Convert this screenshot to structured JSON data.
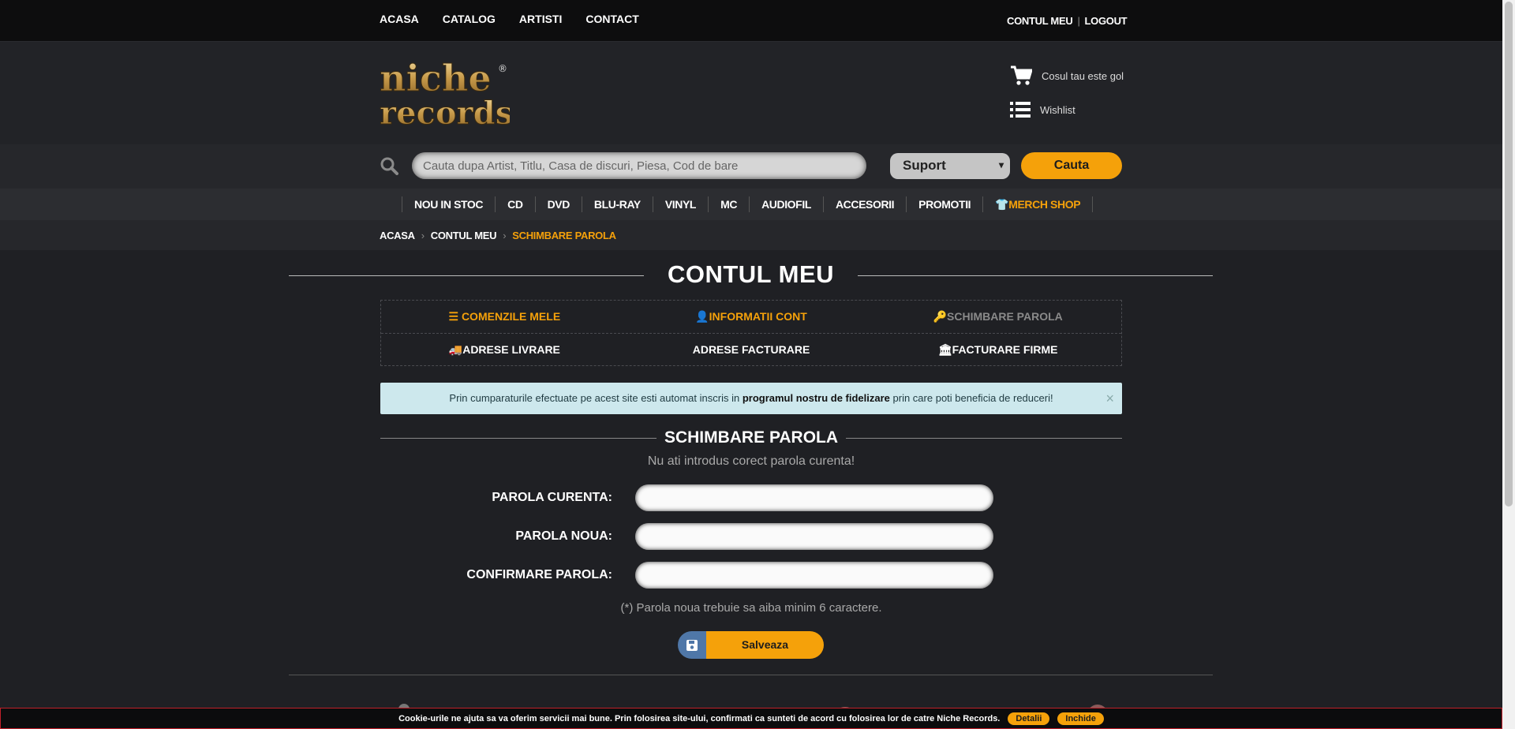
{
  "topnav": {
    "items": [
      "ACASA",
      "CATALOG",
      "ARTISTI",
      "CONTACT"
    ]
  },
  "account": {
    "contul_meu": "CONTUL MEU",
    "logout": "LOGOUT"
  },
  "logo": {
    "line1": "niche",
    "line2": "records",
    "reg": "®"
  },
  "cart": {
    "label": "Cosul tau este gol",
    "icon": "cart-icon"
  },
  "wishlist": {
    "label": "Wishlist",
    "icon": "list-icon"
  },
  "search": {
    "placeholder": "Cauta dupa Artist, Titlu, Casa de discuri, Piesa, Cod de bare",
    "suport": "Suport",
    "button": "Cauta"
  },
  "categories": [
    "NOU IN STOC",
    "CD",
    "DVD",
    "BLU-RAY",
    "VINYL",
    "MC",
    "AUDIOFIL",
    "ACCESORII",
    "PROMOTII",
    "MERCH SHOP"
  ],
  "breadcrumb": [
    "ACASA",
    "CONTUL MEU",
    "SCHIMBARE PAROLA"
  ],
  "page_title": "CONTUL MEU",
  "account_menu": {
    "comenzi": "COMENZILE MELE",
    "informatii": "INFORMATII CONT",
    "schimbare": "SCHIMBARE PAROLA",
    "adrese_livrare": "ADRESE LIVRARE",
    "adrese_facturare": "ADRESE FACTURARE",
    "facturare_firme": "FACTURARE FIRME"
  },
  "alert": {
    "before": "Prin cumparaturile efectuate pe acest site esti automat inscris in ",
    "bold": "programul nostru de fidelizare",
    "after": " prin care poti beneficia de reduceri!",
    "close": "×"
  },
  "section_title": "SCHIMBARE PAROLA",
  "error": "Nu ati introdus corect parola curenta!",
  "fields": {
    "current": "PAROLA CURENTA:",
    "new": "PAROLA NOUA:",
    "confirm": "CONFIRMARE PAROLA:"
  },
  "hint": "(*) Parola noua trebuie sa aiba minim 6 caractere.",
  "save": "Salveaza",
  "cookie": {
    "text": "Cookie-urile ne ajuta sa va oferim servicii mai bune. Prin folosirea site-ului, confirmati ca sunteti de acord cu folosirea lor de catre Niche Records.",
    "detalii": "Detalii",
    "inchide": "Inchide"
  },
  "colors": {
    "accent": "#f5a10a",
    "background": "#1f2024",
    "alert_bg": "#cde8ed",
    "save_icon_bg": "#4f77a8"
  }
}
